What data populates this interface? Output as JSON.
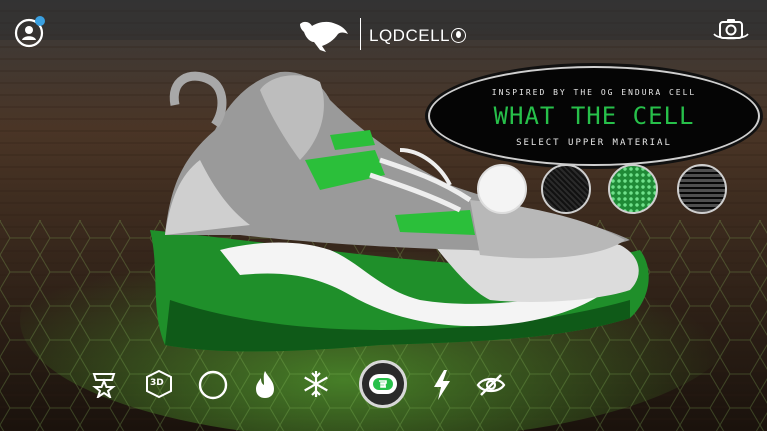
{
  "header": {
    "brand": "LQDCELL",
    "profile_badge": "",
    "icons": {
      "profile": "profile-icon",
      "brand_logo": "puma-logo",
      "ar_camera": "ar-camera-icon"
    }
  },
  "panel": {
    "kicker": "INSPIRED BY THE OG ENDURA CELL",
    "title": "WHAT THE CELL",
    "subtitle": "SELECT UPPER MATERIAL"
  },
  "materials": [
    {
      "name": "white-material",
      "color": "#f2f2f2"
    },
    {
      "name": "black-knit-material",
      "color": "#1a1a1a"
    },
    {
      "name": "green-hex-material",
      "color": "#2fb24c"
    },
    {
      "name": "black-white-print-material",
      "color": "#8a8a8a"
    }
  ],
  "toolbar": [
    {
      "name": "awards-icon",
      "label": ""
    },
    {
      "name": "3d-view-icon",
      "label": "3D"
    },
    {
      "name": "circle-icon",
      "label": ""
    },
    {
      "name": "fire-icon",
      "label": ""
    },
    {
      "name": "snowflake-icon",
      "label": ""
    },
    {
      "name": "cell-logo-icon",
      "label": "",
      "selected": true
    },
    {
      "name": "lightning-icon",
      "label": ""
    },
    {
      "name": "hide-icon",
      "label": ""
    }
  ],
  "colors": {
    "accent_green": "#27c04a",
    "panel_bg": "#050505"
  }
}
